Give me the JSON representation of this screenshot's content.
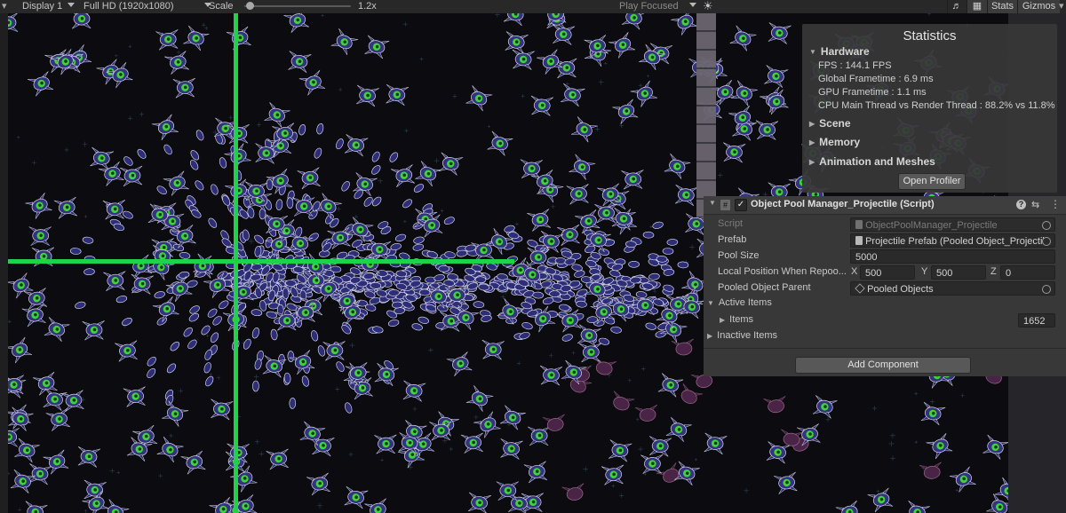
{
  "toolbar": {
    "display": "Display 1",
    "resolution": "Full HD (1920x1080)",
    "scale_label": "Scale",
    "scale_value": "1.2x",
    "play_mode": "Play Focused",
    "stats": "Stats",
    "gizmos": "Gizmos"
  },
  "stats": {
    "title": "Statistics",
    "hardware": "Hardware",
    "fps": "FPS : 144.1 FPS",
    "global_frametime": "Global Frametime : 6.9 ms",
    "gpu_frametime": "GPU Frametime : 1.1 ms",
    "cpu_thread": "CPU Main Thread vs Render Thread : 88.2% vs 11.8%",
    "scene": "Scene",
    "memory": "Memory",
    "animation": "Animation and Meshes",
    "open_profiler": "Open Profiler"
  },
  "inspector": {
    "component_title": "Object Pool Manager_Projectile (Script)",
    "script_label": "Script",
    "script_value": "ObjectPoolManager_Projectile",
    "prefab_label": "Prefab",
    "prefab_value": "Projectile Prefab (Pooled Object_Projectile",
    "pool_size_label": "Pool Size",
    "pool_size_value": "5000",
    "local_pos_label": "Local Position When Repoo...",
    "x_label": "X",
    "x_value": "500",
    "y_label": "Y",
    "y_value": "500",
    "z_label": "Z",
    "z_value": "0",
    "parent_label": "Pooled Object Parent",
    "parent_value": "Pooled Objects",
    "active_items": "Active Items",
    "items_label": "Items",
    "items_value": "1652",
    "inactive_items": "Inactive Items",
    "add_component": "Add Component"
  },
  "colors": {
    "crosshair": "#1ed24a",
    "enemy_body": "#3a3a8c",
    "enemy_eye": "#46d23c",
    "enemy_dark": "#5a2a52",
    "background": "#0b0b10"
  }
}
